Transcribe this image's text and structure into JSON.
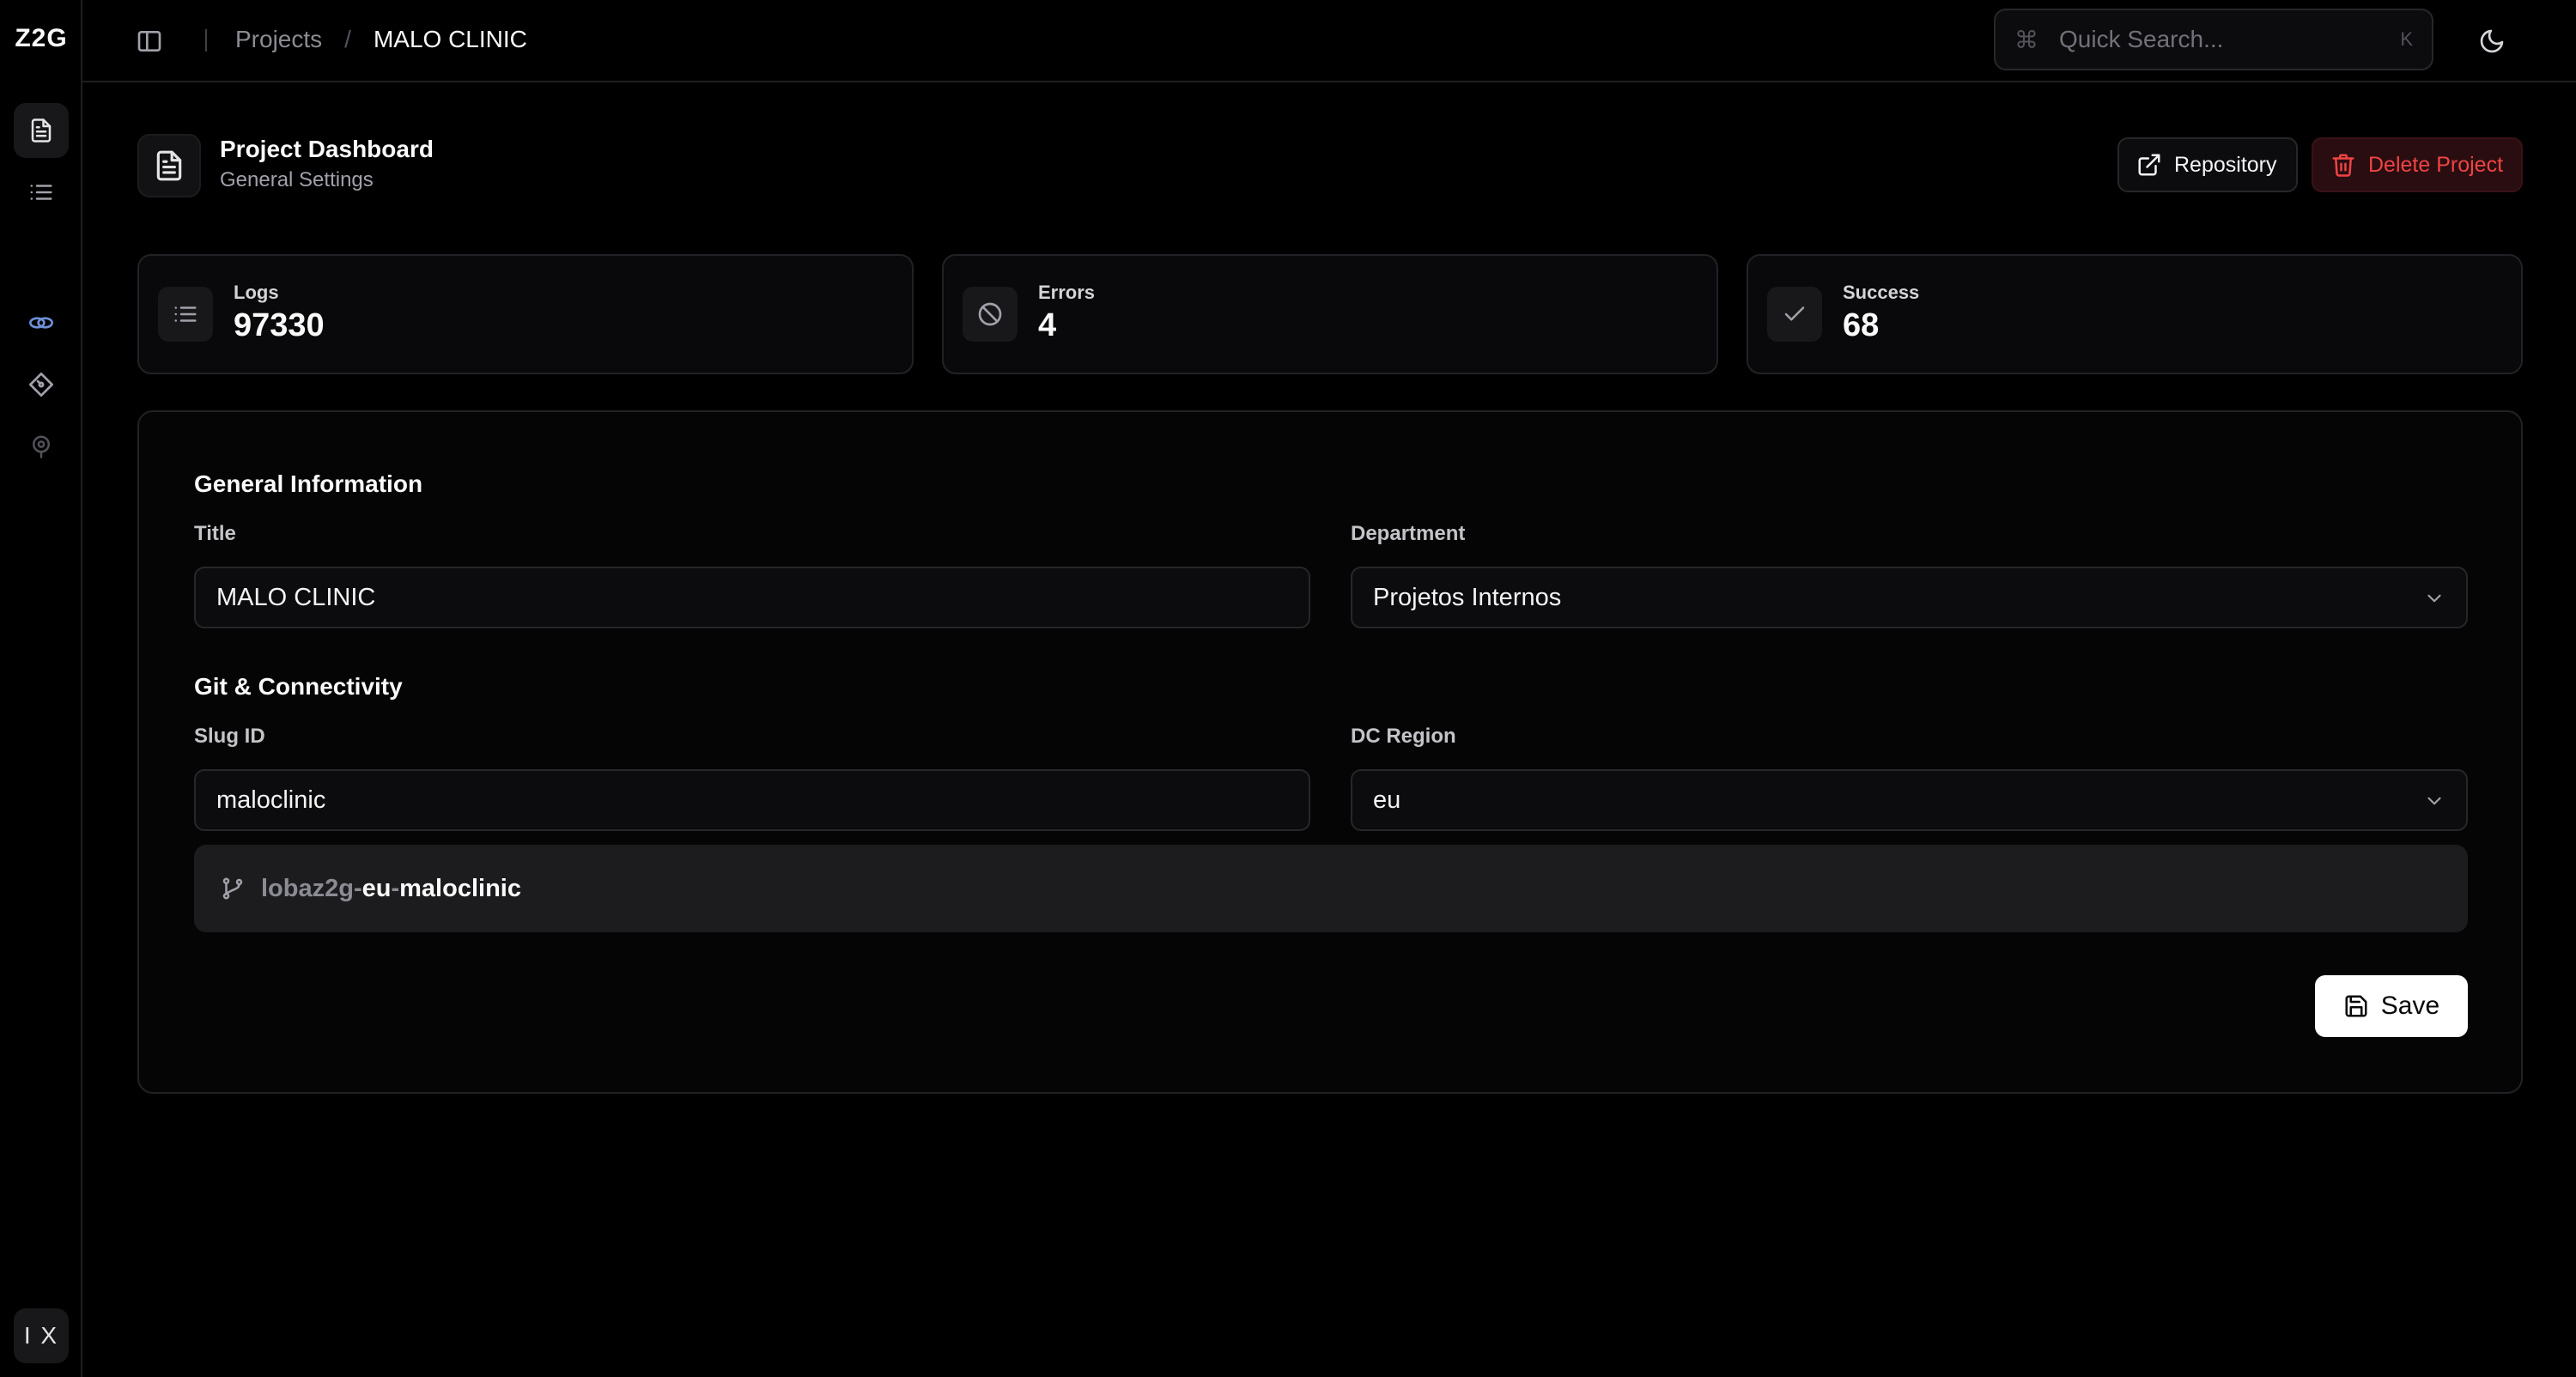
{
  "app": {
    "brand": "Z2G"
  },
  "user": {
    "initials": "I X"
  },
  "breadcrumb": {
    "parent": "Projects",
    "separator": "/",
    "current": "MALO CLINIC"
  },
  "search": {
    "placeholder": "Quick Search...",
    "shortcut_symbol": "⌘",
    "shortcut_key": "K"
  },
  "sidebar": {
    "items": [
      {
        "icon": "document-icon",
        "active": true
      },
      {
        "icon": "list-icon",
        "active": false
      },
      {
        "icon": "link-icon",
        "active": false,
        "color": "#6d8fd6"
      },
      {
        "icon": "git-diamond-icon",
        "active": false
      },
      {
        "icon": "pin-icon",
        "active": false
      }
    ]
  },
  "header": {
    "title": "Project Dashboard",
    "subtitle": "General Settings",
    "repository_label": "Repository",
    "delete_label": "Delete Project",
    "delete_color": "#ef4444"
  },
  "stats": [
    {
      "label": "Logs",
      "value": "97330",
      "icon": "list-icon"
    },
    {
      "label": "Errors",
      "value": "4",
      "icon": "ban-icon"
    },
    {
      "label": "Success",
      "value": "68",
      "icon": "check-icon"
    }
  ],
  "general": {
    "section_title": "General Information",
    "title_label": "Title",
    "title_value": "MALO CLINIC",
    "department_label": "Department",
    "department_value": "Projetos Internos"
  },
  "git": {
    "section_title": "Git & Connectivity",
    "slug_label": "Slug ID",
    "slug_value": "maloclinic",
    "region_label": "DC Region",
    "region_value": "eu",
    "repo_prefix": "lobaz2g-",
    "repo_region": "eu",
    "repo_dash": "-",
    "repo_slug": "maloclinic"
  },
  "actions": {
    "save_label": "Save"
  }
}
